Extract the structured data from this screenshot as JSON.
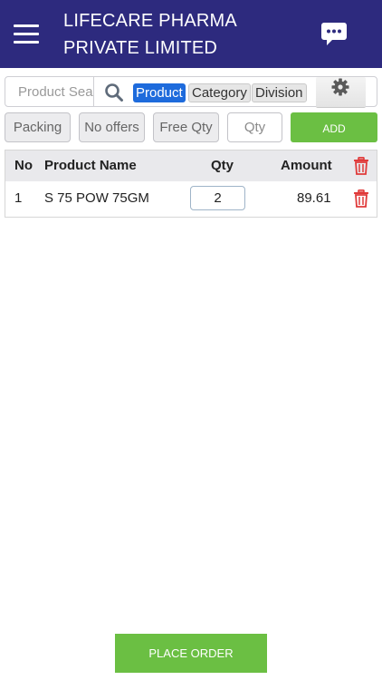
{
  "header": {
    "title": "LIFECARE PHARMA PRIVATE LIMITED",
    "menu_icon": "hamburger-menu-icon",
    "chat_icon": "chat-bubble-icon",
    "background_color": "#2d2a7e"
  },
  "search": {
    "placeholder": "Product Search",
    "value": "",
    "search_icon": "search-icon",
    "filters": [
      {
        "label": "Product",
        "active": true
      },
      {
        "label": "Category",
        "active": false
      },
      {
        "label": "Division",
        "active": false
      }
    ],
    "settings_icon": "gear-icon"
  },
  "actions": {
    "packing": "Packing",
    "offers": "No offers",
    "free_qty": "Free Qty",
    "qty_placeholder": "Qty",
    "add": "ADD",
    "accent_color": "#6bbf43"
  },
  "table": {
    "columns": {
      "no": "No",
      "name": "Product Name",
      "qty": "Qty",
      "amount": "Amount"
    },
    "rows": [
      {
        "no": "1",
        "name": "S 75 POW 75GM",
        "qty": "2",
        "amount": "89.61"
      }
    ]
  },
  "footer": {
    "place_order": "PLACE ORDER"
  }
}
